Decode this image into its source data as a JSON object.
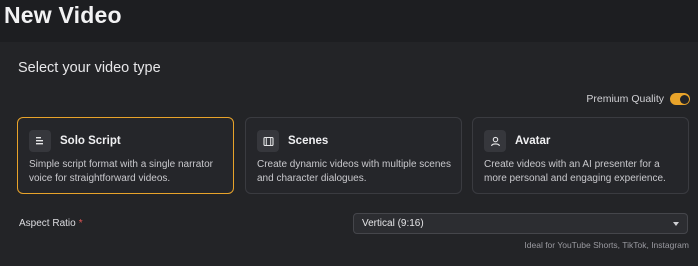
{
  "header": {
    "title": "New Video"
  },
  "main": {
    "section_title": "Select your video type",
    "premium": {
      "label": "Premium Quality",
      "enabled": true
    },
    "video_types": [
      {
        "title": "Solo Script",
        "description": "Simple script format with a single narrator voice for straightforward videos.",
        "icon": "script-lines-icon",
        "selected": true
      },
      {
        "title": "Scenes",
        "description": "Create dynamic videos with multiple scenes and character dialogues.",
        "icon": "film-icon",
        "selected": false
      },
      {
        "title": "Avatar",
        "description": "Create videos with an AI presenter for a more personal and engaging experience.",
        "icon": "person-icon",
        "selected": false
      }
    ],
    "aspect_ratio": {
      "label": "Aspect Ratio",
      "required_mark": "*",
      "value": "Vertical (9:16)",
      "hint": "Ideal for YouTube Shorts, TikTok, Instagram"
    }
  },
  "colors": {
    "accent": "#e8a32a",
    "background": "#1d1e21",
    "required": "#e25555"
  }
}
